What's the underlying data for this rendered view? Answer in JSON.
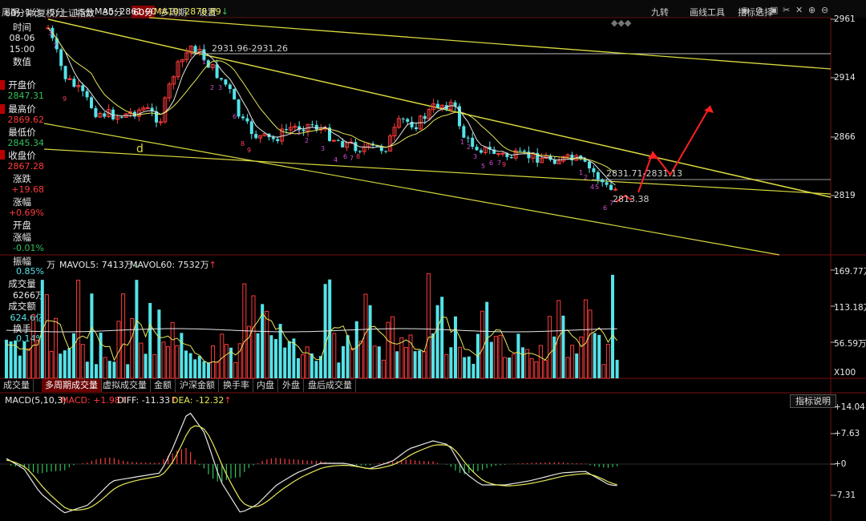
{
  "toolbar": {
    "items": [
      "周期",
      "1分",
      "5分",
      "15分",
      "30分",
      "60分",
      "多周期",
      "设置"
    ],
    "right_items": [
      "九转",
      "画线工具",
      "指标选择"
    ],
    "icons": [
      "eye-icon",
      "eye-closed-icon",
      "lock-icon",
      "scissors-icon",
      "plus-icon",
      "minus-icon",
      "settings-icon"
    ]
  },
  "chart_header": {
    "period": "60分钟(复权)",
    "title": "上证指数",
    "ma5": "MA5: 2861.00",
    "ma5_arrow": "↑",
    "ma10": "MA10: 2878.89",
    "ma10_arrow": "↓"
  },
  "side_panel": {
    "time_label": "时间",
    "date": "08-06",
    "time": "15:00",
    "value_label": "数值",
    "open_label": "开盘价",
    "open_value": "2847.31",
    "high_label": "最高价",
    "high_value": "2869.62",
    "low_label": "最低价",
    "low_value": "2845.34",
    "close_label": "收盘价",
    "close_value": "2867.28",
    "change_label": "涨跌",
    "change_value": "+19.68",
    "pct_label": "涨幅",
    "pct_value": "+0.69%",
    "open_pct_label_1": "开盘",
    "open_pct_label_2": "涨幅",
    "open_pct_value": "-0.01%",
    "amp_label": "振幅",
    "amp_value": "0.85%",
    "vol_label": "成交量",
    "vol_value": "6266万",
    "amt_label": "成交额",
    "amt_value": "624.6亿",
    "turnover_label": "换手",
    "turnover_value": "0.14%"
  },
  "price_axis": [
    "2961",
    "2914",
    "2866",
    "2819"
  ],
  "annotations": {
    "top_level": "2931.96-2931.26",
    "mid_level": "2831.71-2831.13",
    "low_point": "2813.38",
    "wave_label": "d"
  },
  "volume_header": {
    "prefix": "万",
    "mavol5": "MAVOL5: 7413万",
    "mavol5_arrow": "↓",
    "mavol60": "MAVOL60: 7532万",
    "mavol60_arrow": "↑"
  },
  "volume_axis": [
    "169.77万",
    "113.18万",
    "56.59万",
    "X100"
  ],
  "tabs": [
    "成交量",
    "多周期成交量",
    "虚拟成交量",
    "金额",
    "沪深金额",
    "换手率",
    "内盘",
    "外盘",
    "盘后成交量"
  ],
  "macd_header": {
    "params": "MACD(5,10,3)",
    "macd": "MACD: +1.98",
    "macd_arrow": "↑",
    "diff": "DIFF: -11.33",
    "diff_arrow": "↑",
    "dea": "DEA: -12.32",
    "dea_arrow": "↑"
  },
  "macd_axis": [
    "+14.04",
    "+7.63",
    "+0",
    "-7.31"
  ],
  "indicator_button": "指标说明",
  "colors": {
    "up": "#ff3b3b",
    "down": "#54e3e8",
    "ma_yellow": "#e8e85a",
    "ma_white": "#e6e6e6",
    "green": "#31c25a",
    "accent_red": "#ff2020"
  }
}
